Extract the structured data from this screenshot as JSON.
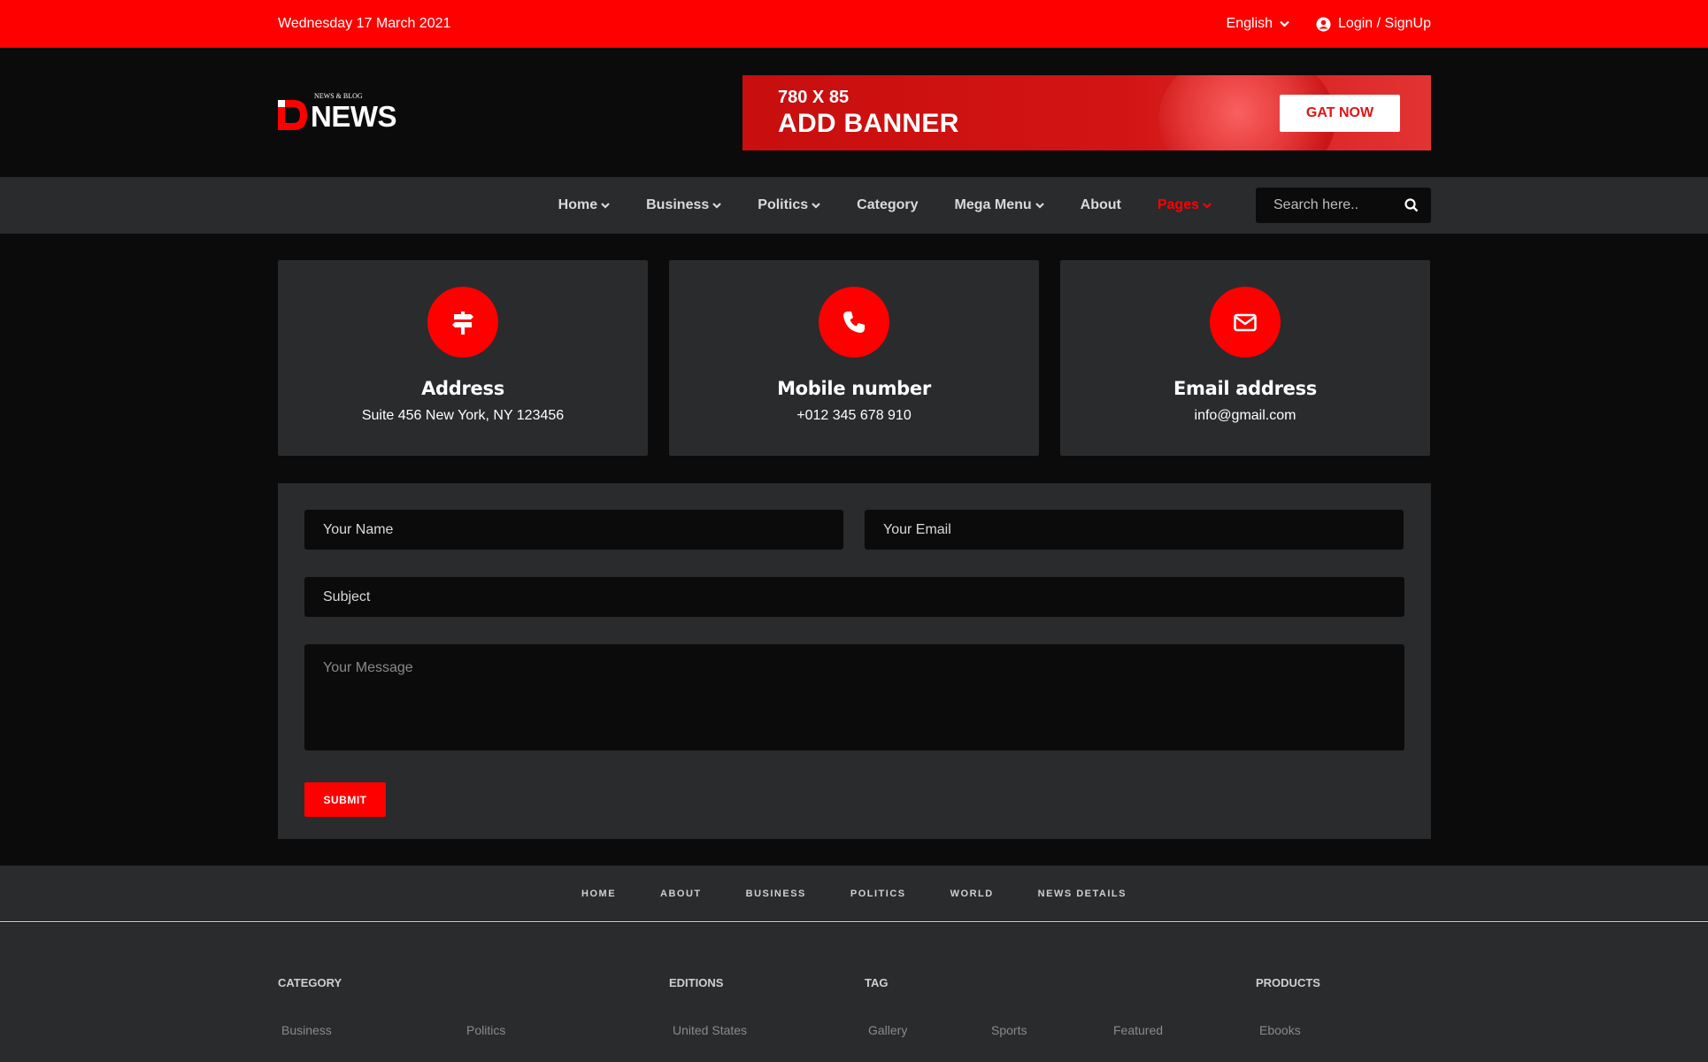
{
  "topbar": {
    "date": "Wednesday 17 March 2021",
    "language": "English",
    "login": "Login / SignUp"
  },
  "header": {
    "logo_word": "NEWS",
    "logo_tag": "NEWS & BLOG",
    "banner": {
      "size": "780 X 85",
      "title": "ADD BANNER",
      "cta": "GAT NOW"
    }
  },
  "nav": {
    "items": [
      {
        "label": "Home",
        "dropdown": true
      },
      {
        "label": "Business",
        "dropdown": true
      },
      {
        "label": "Politics",
        "dropdown": true
      },
      {
        "label": "Category",
        "dropdown": false
      },
      {
        "label": "Mega Menu",
        "dropdown": true
      },
      {
        "label": "About",
        "dropdown": false
      },
      {
        "label": "Pages",
        "dropdown": true,
        "active": true
      }
    ],
    "search_placeholder": "Search here.."
  },
  "cards": [
    {
      "icon": "signpost-icon",
      "title": "Address",
      "value": "Suite 456 New York, NY 123456"
    },
    {
      "icon": "phone-icon",
      "title": "Mobile number",
      "value": "+012 345 678 910"
    },
    {
      "icon": "envelope-icon",
      "title": "Email address",
      "value": "info@gmail.com"
    }
  ],
  "form": {
    "name_placeholder": "Your Name",
    "email_placeholder": "Your Email",
    "subject_placeholder": "Subject",
    "message_placeholder": "Your Message",
    "submit_label": "SUBMIT"
  },
  "footer_nav": [
    "HOME",
    "ABOUT",
    "BUSINESS",
    "POLITICS",
    "WORLD",
    "NEWS DETAILS"
  ],
  "footer": {
    "category_title": "CATEGORY",
    "editions_title": "EDITIONS",
    "tag_title": "TAG",
    "products_title": "PRODUCTS",
    "category_links": [
      "Business",
      "Politics"
    ],
    "editions_links": [
      "United States"
    ],
    "tag_links": [
      "Gallery",
      "Sports",
      "Featured"
    ],
    "products_links": [
      "Ebooks"
    ]
  },
  "colors": {
    "accent": "#fe0000",
    "panel": "#2a2b2d",
    "background": "#0b0b0c"
  }
}
